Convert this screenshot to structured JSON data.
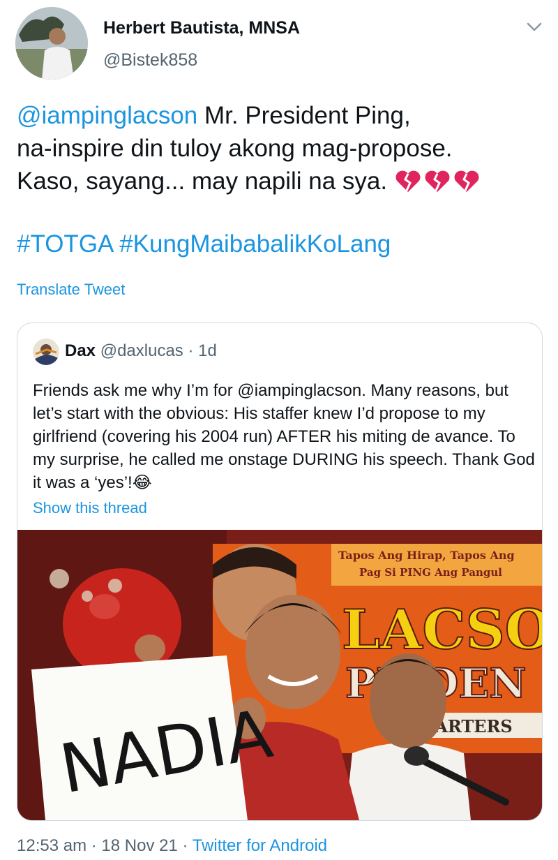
{
  "author": {
    "display_name": "Herbert Bautista, MNSA",
    "handle": "@Bistek858"
  },
  "tweet": {
    "mention": "@iampinglacson",
    "text_line1_rest": " Mr. President Ping,",
    "text_line2": "na-inspire din tuloy akong mag-propose.",
    "text_line3": "Kaso, sayang... may napili na sya.",
    "emoji": "broken-heart x3",
    "hashtag1": "#TOTGA",
    "hashtag2": "#KungMaibabalikKoLang",
    "translate_label": "Translate Tweet"
  },
  "quoted_tweet": {
    "name": "Dax",
    "handle": "@daxlucas",
    "time": "1d",
    "text_part1": "Friends ask me why I’m for ",
    "mention": "@iampinglacson",
    "text_part2": ". Many reasons, but let’s start with the obvious: His staffer knew I’d propose to my girlfriend (covering his 2004 run) AFTER his miting de avance. To my surprise, he called me onstage DURING his speech. Thank God it was a ‘yes’!",
    "emoji": "😂",
    "show_thread_label": "Show this thread",
    "photo_banner_line1": "Tapos Ang Hirap, Tapos Ang",
    "photo_banner_line2": "Pag Si PING Ang Pangul",
    "photo_banner_big": "LACSO",
    "photo_banner_row2": "PR   DEN",
    "photo_banner_row3": "UARTERS",
    "photo_sign": "NADIA"
  },
  "footer": {
    "time": "12:53 am",
    "date": "18 Nov 21",
    "source": "Twitter for Android",
    "separator": " · "
  },
  "colors": {
    "link": "#1b95e0",
    "text": "#0f1419",
    "secondary": "#536471",
    "border": "#cfd9de",
    "heart": "#e0245e"
  }
}
